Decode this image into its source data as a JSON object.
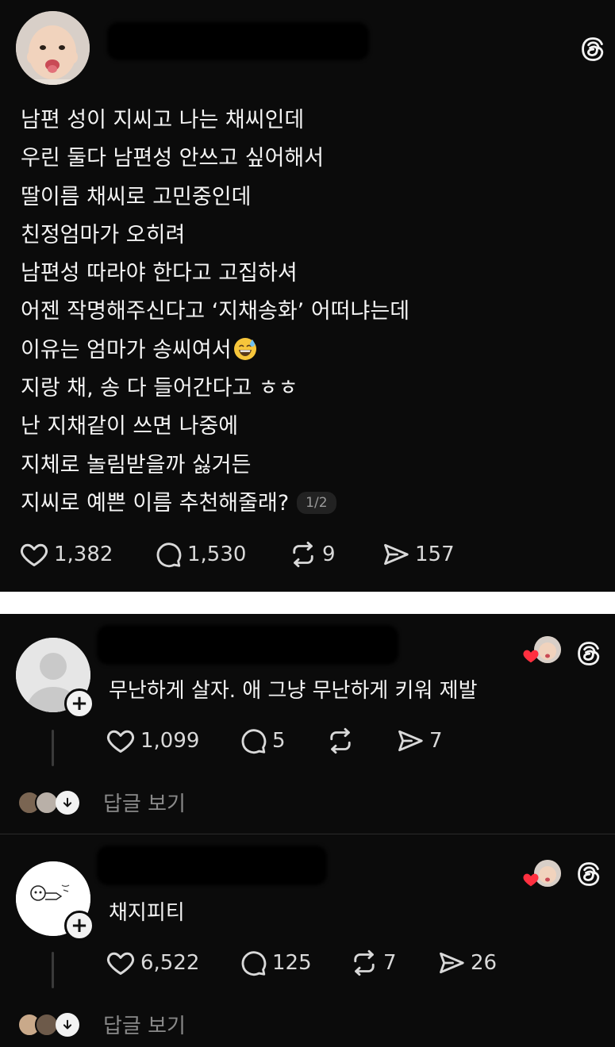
{
  "post": {
    "lines": [
      "남편 성이 지씨고 나는 채씨인데",
      "우린 둘다 남편성 안쓰고 싶어해서",
      "딸이름 채씨로 고민중인데",
      "친정엄마가 오히려",
      "남편성 따라야 한다고 고집하셔",
      "어젠 작명해주신다고 ‘지채송화’ 어떠냐는데",
      "이유는 엄마가 송씨여서",
      "지랑 채, 송 다 들어간다고 ㅎㅎ",
      "난 지채같이 쓰면 나중에",
      "지체로 놀림받을까 싫거든",
      "지씨로 예쁜 이름 추천해줄래?"
    ],
    "page_indicator": "1/2",
    "likes": "1,382",
    "comments": "1,530",
    "reposts": "9",
    "shares": "157"
  },
  "comments": [
    {
      "text": "무난하게 살자. 애 그냥 무난하게 키워 제발",
      "likes": "1,099",
      "replies": "5",
      "reposts": "",
      "shares": "7",
      "view_replies": "답글 보기"
    },
    {
      "text": "채지피티",
      "likes": "6,522",
      "replies": "125",
      "reposts": "7",
      "shares": "26",
      "view_replies": "답글 보기"
    }
  ],
  "colors": {
    "background": "#0b0b0b",
    "text": "#f3f3f3",
    "muted": "#8a8a8a",
    "like_heart": "#ff3040"
  },
  "icons": [
    "heart-icon",
    "comment-icon",
    "repost-icon",
    "share-icon",
    "threads-logo-icon",
    "plus-icon",
    "arrow-down-icon"
  ]
}
